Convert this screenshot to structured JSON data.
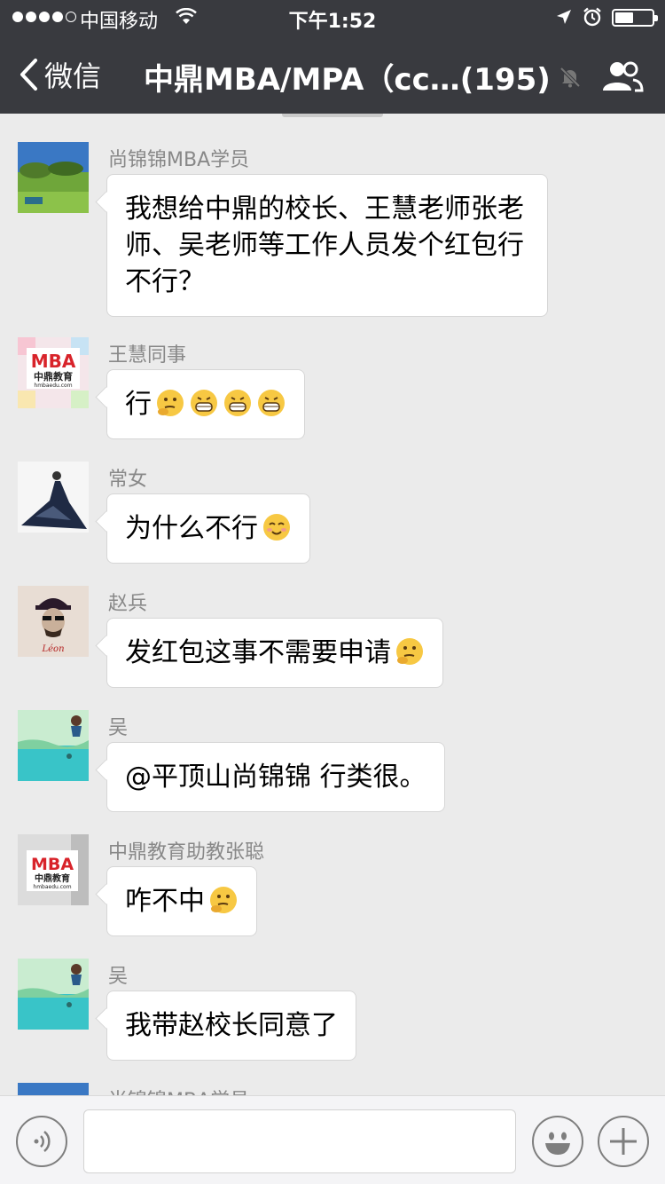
{
  "status_bar": {
    "carrier": "中国移动",
    "time": "下午1:52",
    "icons": [
      "signal-dots-icon",
      "wifi-icon",
      "location-arrow-icon",
      "alarm-clock-icon",
      "battery-icon"
    ]
  },
  "nav": {
    "back_label": "微信",
    "title": "中鼎MBA/MPA（cc…(195)",
    "icons": [
      "chevron-left-icon",
      "mute-bell-icon",
      "group-members-icon"
    ]
  },
  "messages": [
    {
      "sender": "尚锦锦MBA学员",
      "text": "我想给中鼎的校长、王慧老师张老师、吴老师等工作人员发个红包行不行？",
      "emojis": []
    },
    {
      "sender": "王慧同事",
      "text": "行",
      "emojis": [
        "thinking-emoji",
        "grin-emoji",
        "grin-emoji",
        "grin-emoji"
      ]
    },
    {
      "sender": "常女",
      "text": "为什么不行",
      "emojis": [
        "blush-emoji"
      ]
    },
    {
      "sender": "赵兵",
      "text": "发红包这事不需要申请",
      "emojis": [
        "thinking-emoji"
      ]
    },
    {
      "sender": "吴",
      "text": "@平顶山尚锦锦 行类很。",
      "emojis": []
    },
    {
      "sender": "中鼎教育助教张聪",
      "text": "咋不中",
      "emojis": [
        "thinking-emoji"
      ]
    },
    {
      "sender": "吴",
      "text": "我带赵校长同意了",
      "emojis": []
    },
    {
      "sender": "尚锦锦MBA学员",
      "text": "",
      "emojis": []
    }
  ],
  "avatar_text": {
    "mba_logo_top": "MBA",
    "mba_logo_mid": "中鼎教育",
    "mba_logo_url": "hmbaedu.com",
    "leon": "Léon"
  },
  "input_bar": {
    "value": "",
    "icons": [
      "voice-icon",
      "emoji-smile-icon",
      "plus-icon"
    ]
  },
  "colors": {
    "nav_bg": "#393a3f",
    "chat_bg": "#ebebeb",
    "bubble_bg": "#ffffff",
    "sender_text": "#888888"
  }
}
